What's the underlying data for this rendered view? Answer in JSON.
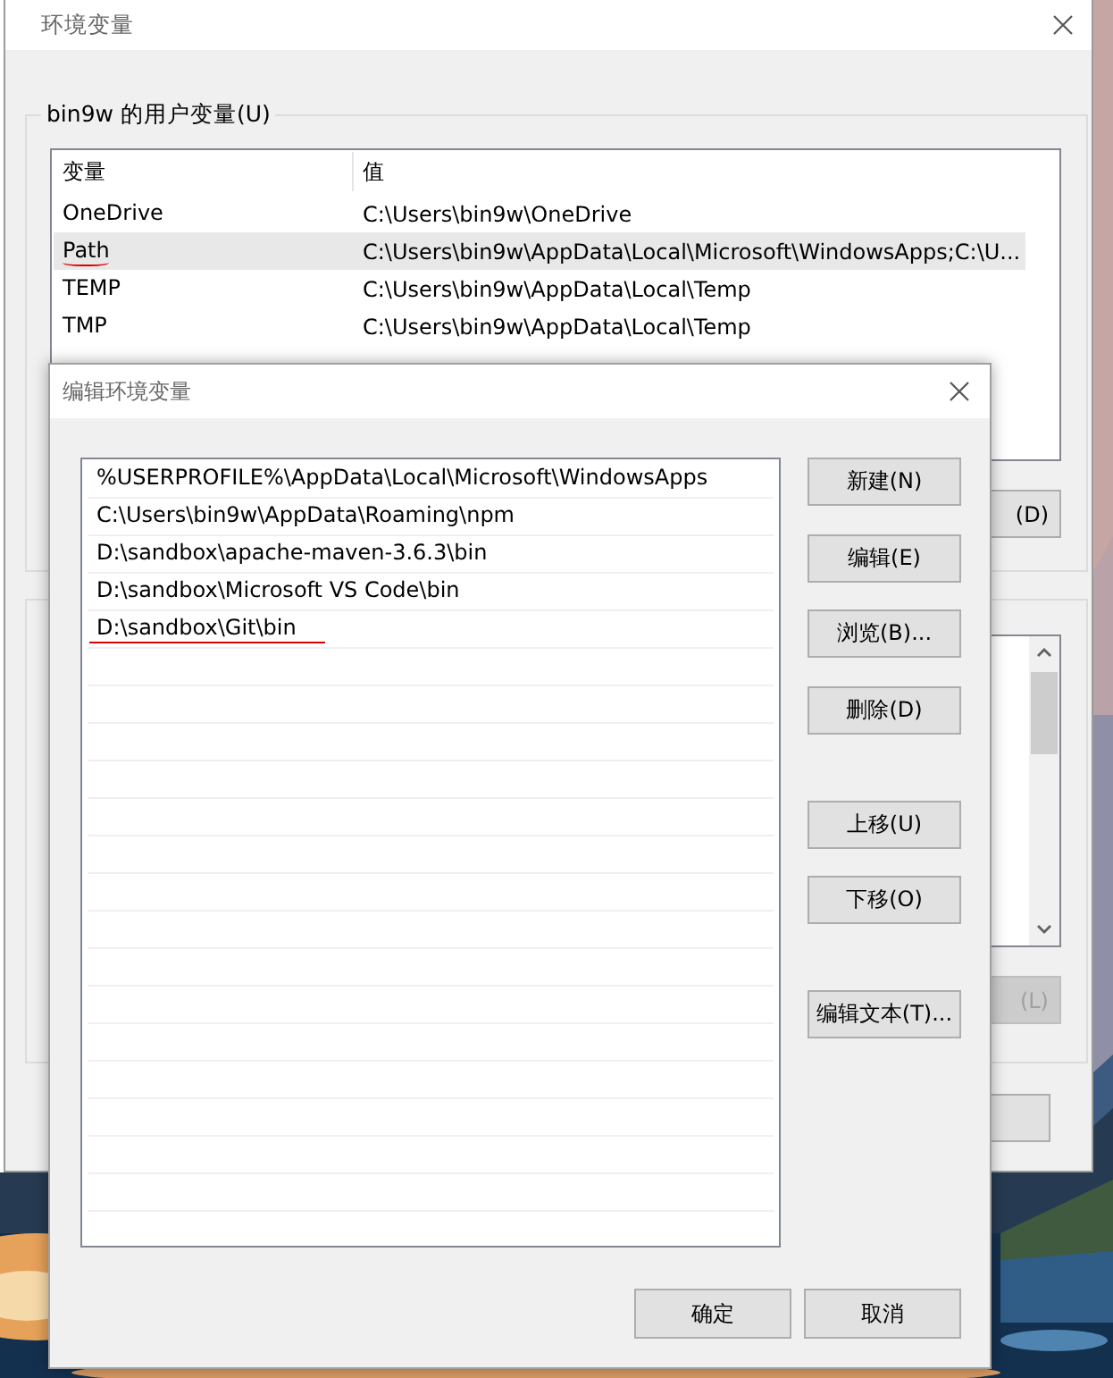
{
  "env_window": {
    "title": "环境变量",
    "user_group": {
      "label": "bin9w 的用户变量(U)",
      "columns": [
        "变量",
        "值"
      ],
      "rows": [
        {
          "name": "OneDrive",
          "value": "C:\\Users\\bin9w\\OneDrive",
          "selected": false,
          "underlined": false
        },
        {
          "name": "Path",
          "value": "C:\\Users\\bin9w\\AppData\\Local\\Microsoft\\WindowsApps;C:\\U...",
          "selected": true,
          "underlined": true
        },
        {
          "name": "TEMP",
          "value": "C:\\Users\\bin9w\\AppData\\Local\\Temp",
          "selected": false,
          "underlined": false
        },
        {
          "name": "TMP",
          "value": "C:\\Users\\bin9w\\AppData\\Local\\Temp",
          "selected": false,
          "underlined": false
        }
      ],
      "button": {
        "label": "(D)",
        "disabled": false
      }
    },
    "system_group": {
      "button": {
        "label": "(L)",
        "disabled": true
      }
    }
  },
  "edit_window": {
    "title": "编辑环境变量",
    "entries": [
      {
        "text": "%USERPROFILE%\\AppData\\Local\\Microsoft\\WindowsApps",
        "underlined": false
      },
      {
        "text": "C:\\Users\\bin9w\\AppData\\Roaming\\npm",
        "underlined": false
      },
      {
        "text": "D:\\sandbox\\apache-maven-3.6.3\\bin",
        "underlined": false
      },
      {
        "text": "D:\\sandbox\\Microsoft VS Code\\bin",
        "underlined": false
      },
      {
        "text": "D:\\sandbox\\Git\\bin",
        "underlined": true
      }
    ],
    "button_groups": [
      [
        "新建(N)",
        "编辑(E)",
        "浏览(B)...",
        "删除(D)"
      ],
      [
        "上移(U)",
        "下移(O)"
      ],
      [
        "编辑文本(T)..."
      ]
    ],
    "ok": "确定",
    "cancel": "取消"
  }
}
